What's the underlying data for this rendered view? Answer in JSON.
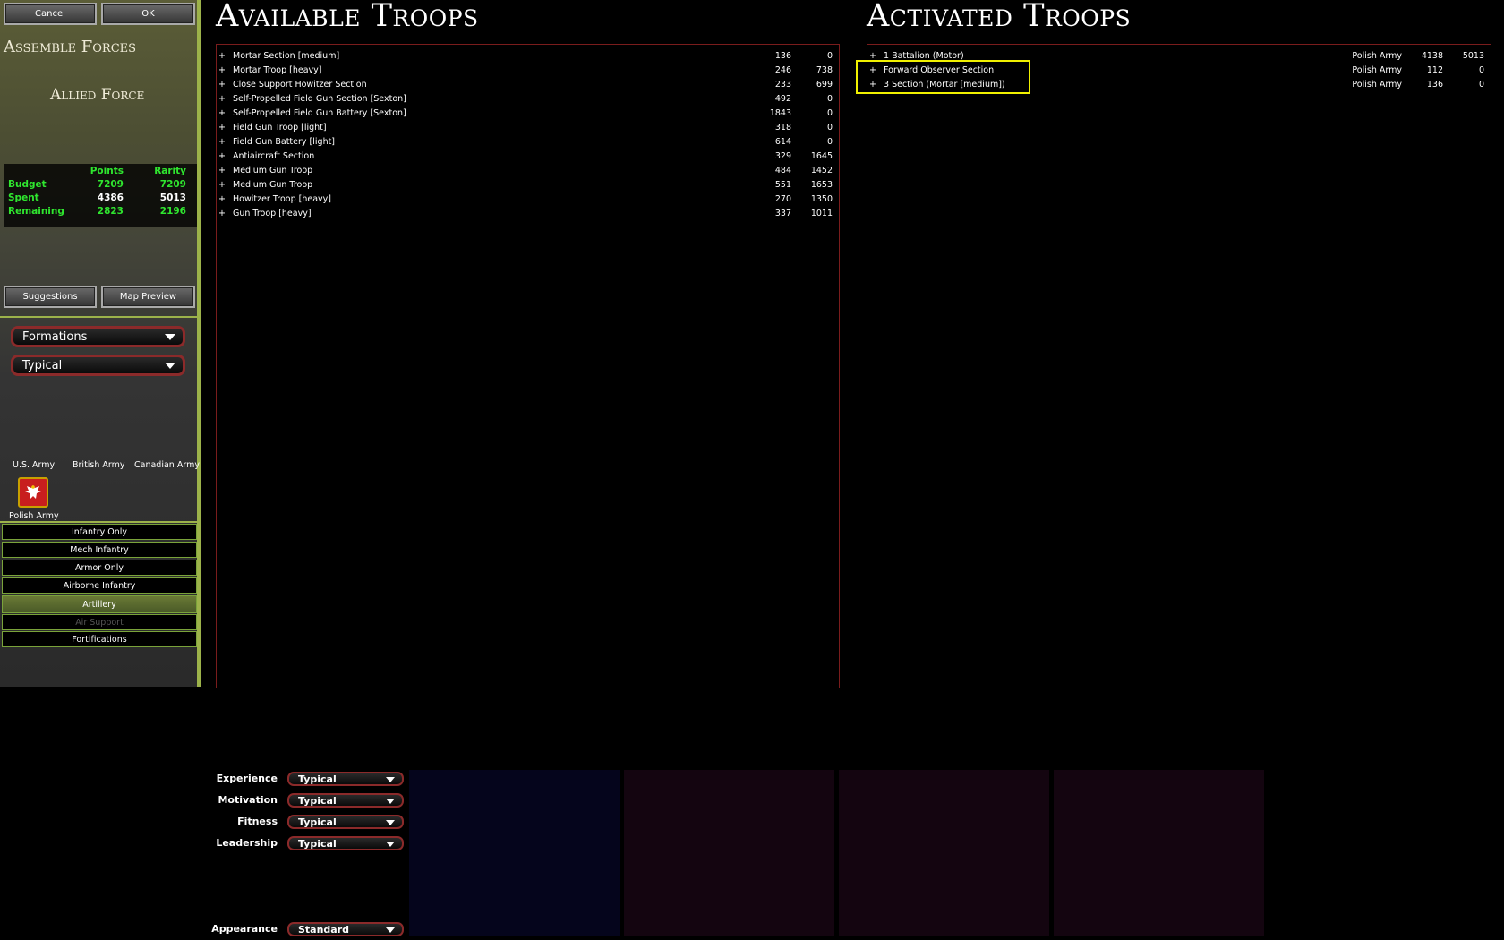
{
  "top_buttons": {
    "cancel": "Cancel",
    "ok": "OK"
  },
  "left": {
    "heading": "Assemble Forces",
    "side": "Allied Force",
    "budget": {
      "col_points": "Points",
      "col_rarity": "Rarity",
      "rows": [
        {
          "label": "Budget",
          "points": "7209",
          "rarity": "7209"
        },
        {
          "label": "Spent",
          "points": "4386",
          "rarity": "5013"
        },
        {
          "label": "Remaining",
          "points": "2823",
          "rarity": "2196"
        }
      ]
    },
    "suggestions": "Suggestions",
    "map_preview": "Map Preview",
    "dropdown1": "Formations",
    "dropdown2": "Typical",
    "armies": [
      "U.S. Army",
      "British Army",
      "Canadian Army",
      "Polish Army"
    ],
    "categories": [
      "Infantry Only",
      "Mech Infantry",
      "Armor Only",
      "Airborne Infantry",
      "Artillery",
      "Air Support",
      "Fortifications"
    ],
    "selected_category": "Artillery",
    "disabled_category": "Air Support"
  },
  "available": {
    "title": "Available Troops",
    "rows": [
      {
        "name": "Mortar Section [medium]",
        "points": "136",
        "rarity": "0"
      },
      {
        "name": "Mortar Troop [heavy]",
        "points": "246",
        "rarity": "738"
      },
      {
        "name": "Close Support Howitzer Section",
        "points": "233",
        "rarity": "699"
      },
      {
        "name": "Self-Propelled Field Gun Section [Sexton]",
        "points": "492",
        "rarity": "0"
      },
      {
        "name": "Self-Propelled Field Gun Battery [Sexton]",
        "points": "1843",
        "rarity": "0"
      },
      {
        "name": "Field Gun Troop [light]",
        "points": "318",
        "rarity": "0"
      },
      {
        "name": "Field Gun Battery [light]",
        "points": "614",
        "rarity": "0"
      },
      {
        "name": "Antiaircraft Section",
        "points": "329",
        "rarity": "1645"
      },
      {
        "name": "Medium Gun Troop",
        "points": "484",
        "rarity": "1452"
      },
      {
        "name": "Medium Gun Troop",
        "points": "551",
        "rarity": "1653"
      },
      {
        "name": "Howitzer Troop [heavy]",
        "points": "270",
        "rarity": "1350"
      },
      {
        "name": "Gun Troop [heavy]",
        "points": "337",
        "rarity": "1011"
      }
    ]
  },
  "activated": {
    "title": "Activated Troops",
    "rows": [
      {
        "name": "1 Battalion (Motor)",
        "army": "Polish Army",
        "points": "4138",
        "rarity": "5013"
      },
      {
        "name": "Forward Observer Section",
        "army": "Polish Army",
        "points": "112",
        "rarity": "0"
      },
      {
        "name": "3 Section (Mortar [medium])",
        "army": "Polish Army",
        "points": "136",
        "rarity": "0"
      }
    ]
  },
  "attributes": [
    {
      "label": "Experience",
      "value": "Typical"
    },
    {
      "label": "Motivation",
      "value": "Typical"
    },
    {
      "label": "Fitness",
      "value": "Typical"
    },
    {
      "label": "Leadership",
      "value": "Typical"
    },
    {
      "label": "Appearance",
      "value": "Standard"
    }
  ],
  "colors": {
    "accent_green": "#2fe62f",
    "panel_border": "#7a1c1c",
    "highlight": "#f0f000"
  }
}
